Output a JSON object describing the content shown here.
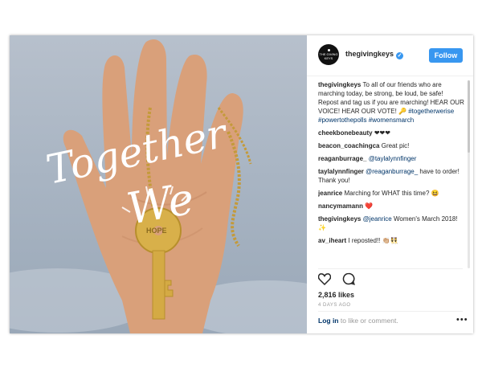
{
  "post": {
    "username": "thegivingkeys",
    "follow_label": "Follow",
    "avatar_text": "THE GIVING KEYS",
    "image_caption_art": {
      "line1": "Together",
      "line2": "We",
      "key_word": "HOPE"
    },
    "comments": [
      {
        "user": "thegivingkeys",
        "text": "To all of our friends who are marching today, be strong, be loud, be safe! Repost and tag us if you are marching! HEAR OUR VOICE! HEAR OUR VOTE! 🔑",
        "tags": "#togetherwerise #powertothepolls #womensmarch"
      },
      {
        "user": "cheekbonebeauty",
        "text": "❤❤❤"
      },
      {
        "user": "beacon_coachingca",
        "text": "Great pic!"
      },
      {
        "user": "reaganburrage_",
        "mention": "@taylalynnfinger",
        "text": ""
      },
      {
        "user": "taylalynnfinger",
        "mention": "@reaganburrage_",
        "text": " have to order! Thank you!"
      },
      {
        "user": "jeanrice",
        "text": "Marching for WHAT this time? 😆"
      },
      {
        "user": "nancymamann",
        "text": "❤️"
      },
      {
        "user": "thegivingkeys",
        "mention": "@jeanrice",
        "text": " Women's March 2018!✨"
      },
      {
        "user": "av_iheart",
        "text": "I reposted!! 👏🏼👯"
      }
    ],
    "likes": "2,816 likes",
    "date": "4 DAYS AGO",
    "login_link": "Log in",
    "login_text": " to like or comment.",
    "more_label": "•••"
  },
  "colors": {
    "accent": "#3897f0",
    "link": "#003569"
  }
}
